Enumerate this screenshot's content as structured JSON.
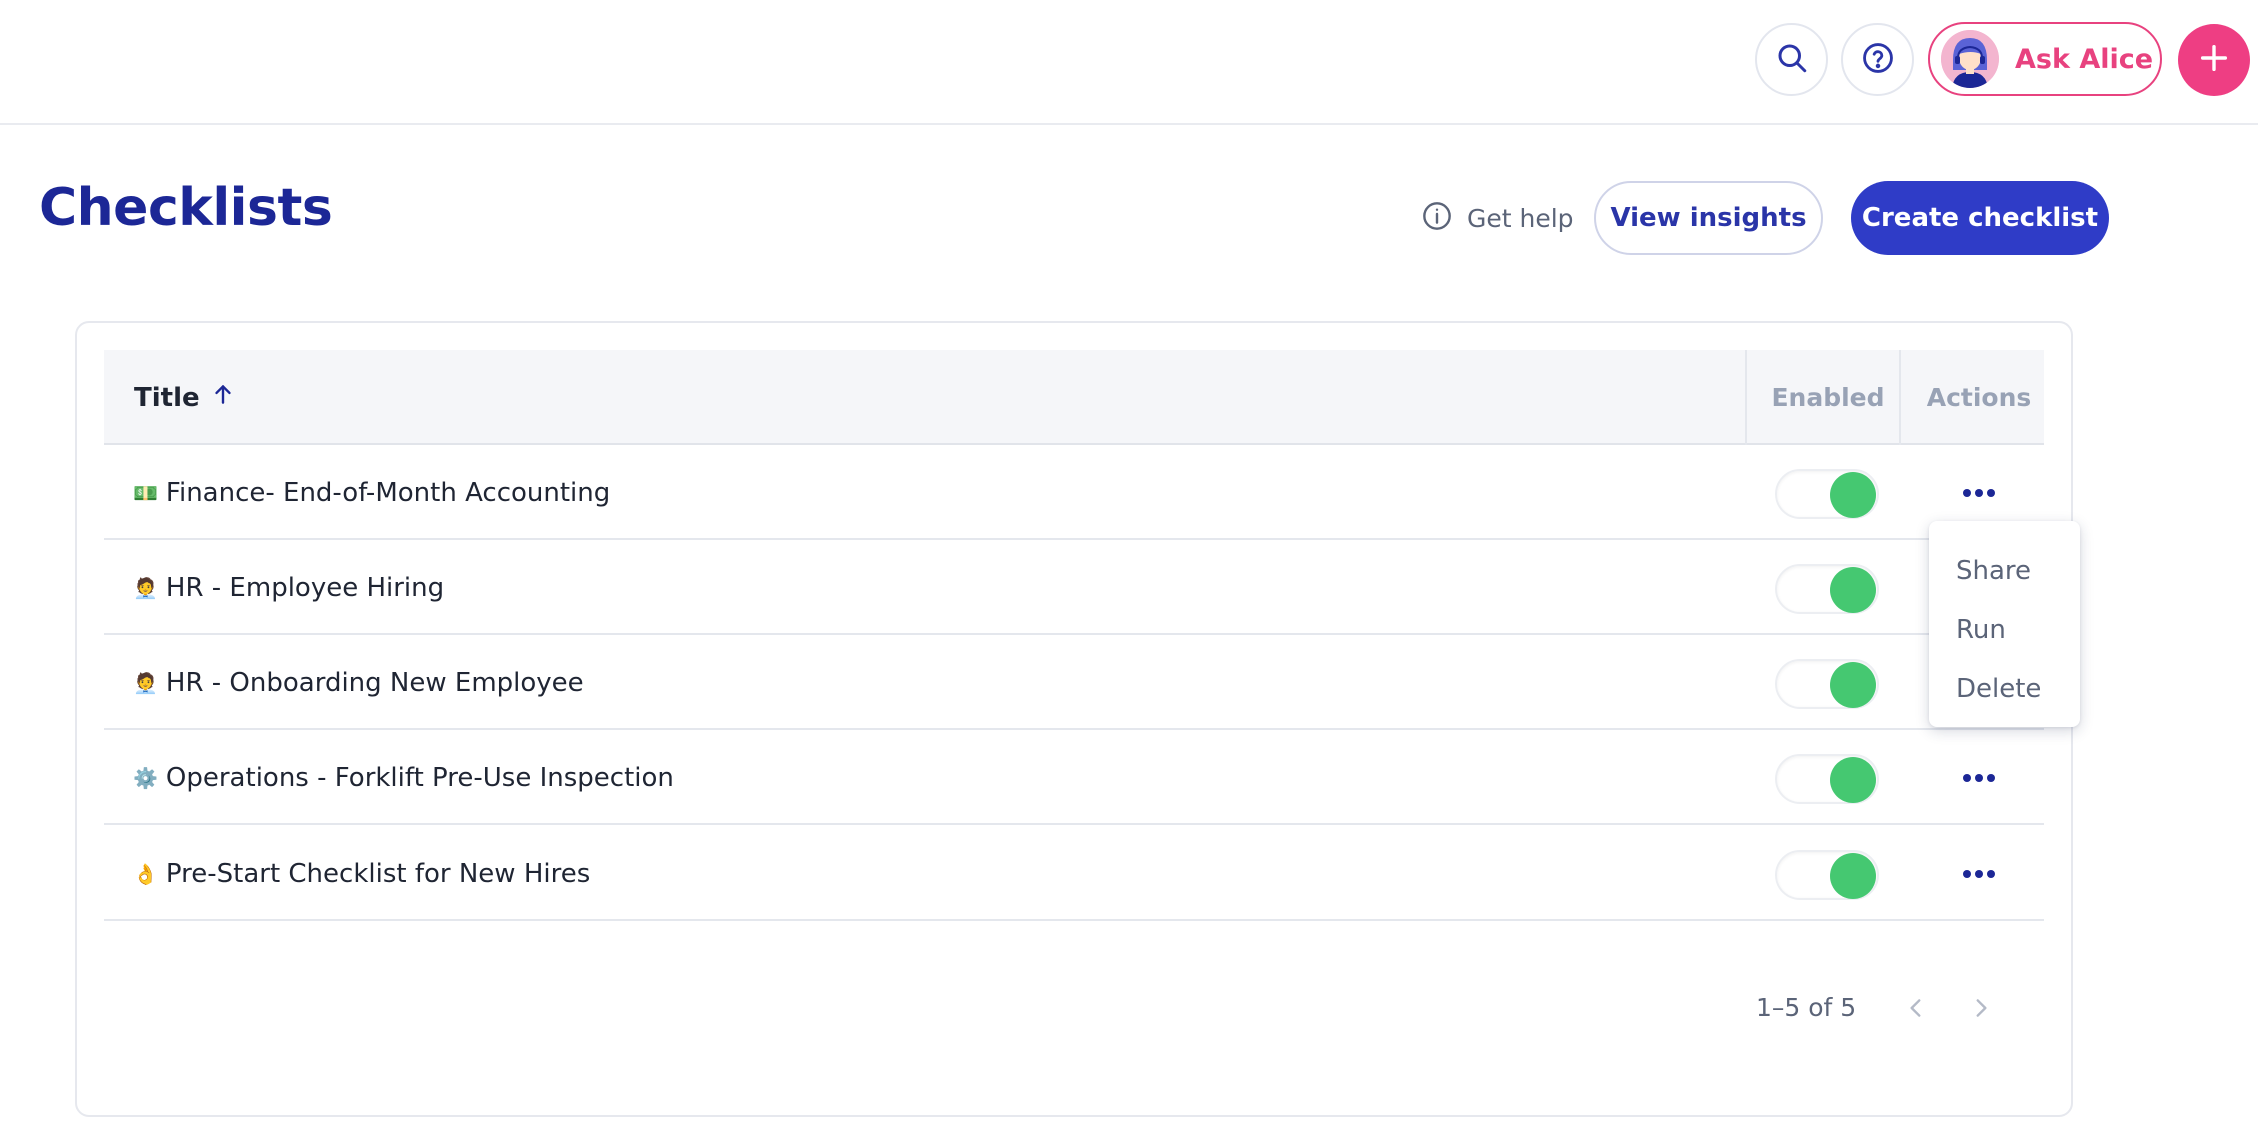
{
  "topbar": {
    "search_icon": "search-icon",
    "help_icon": "help-circle-icon",
    "ask_alice_label": "Ask Alice",
    "plus_icon": "plus-icon"
  },
  "header": {
    "title": "Checklists",
    "get_help_label": "Get help",
    "view_insights_label": "View insights",
    "create_label": "Create checklist"
  },
  "table": {
    "columns": {
      "title": "Title",
      "enabled": "Enabled",
      "actions": "Actions"
    },
    "sort": "ascending",
    "rows": [
      {
        "emoji": "💵",
        "title": "Finance- End-of-Month Accounting",
        "enabled": true
      },
      {
        "emoji": "🧑‍💼",
        "title": "HR - Employee Hiring",
        "enabled": true
      },
      {
        "emoji": "🧑‍💼",
        "title": "HR - Onboarding New Employee",
        "enabled": true
      },
      {
        "emoji": "⚙️",
        "title": "Operations - Forklift Pre-Use Inspection",
        "enabled": true
      },
      {
        "emoji": "👌",
        "title": "Pre-Start Checklist for New Hires",
        "enabled": true
      }
    ]
  },
  "action_menu": {
    "items": [
      "Share",
      "Run",
      "Delete"
    ]
  },
  "pagination": {
    "range_text": "1–5 of 5"
  },
  "colors": {
    "brand_blue": "#2f3cc7",
    "title_blue": "#1c2796",
    "accent_pink": "#ee3e83",
    "toggle_green": "#45c871"
  }
}
